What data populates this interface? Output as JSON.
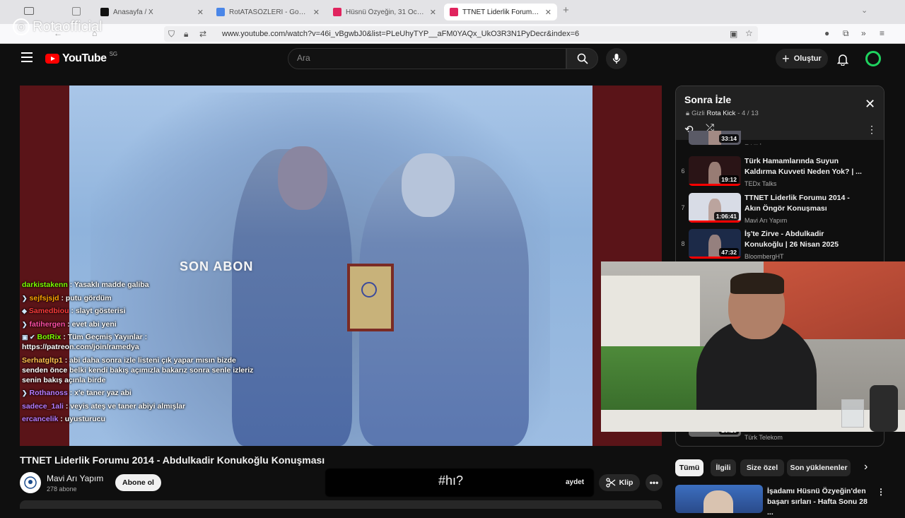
{
  "watermark": "Rotaofficial",
  "tabs": [
    {
      "label": "Anasayfa / X",
      "color": "#111111",
      "active": false
    },
    {
      "label": "RotATASÖZLERİ - Google Dokü",
      "color": "#4a86e8",
      "active": false
    },
    {
      "label": "Hüsnü Özyeğin, 31 Ocak 2017 İ",
      "color": "#e0245e",
      "active": false
    },
    {
      "label": "TTNET Liderlik Forumu 2014 - A",
      "color": "#e0245e",
      "active": true
    }
  ],
  "url": "www.youtube.com/watch?v=46i_vBgwbJ0&list=PLeUhyTYP__aFM0YAQx_UkO3R3N1PyDecr&index=6",
  "header": {
    "logo_text": "YouTube",
    "region": "SG",
    "search_placeholder": "Ara",
    "create_label": "Oluştur"
  },
  "video": {
    "caption": "SON ABON",
    "title": "TTNET Liderlik Forumu 2014 - Abdulkadir Konukoğlu Konuşması",
    "channel": "Mavi Arı Yapım",
    "subscribers": "278 abone",
    "subscribe_label": "Abone ol",
    "overlay_text": "#hı?",
    "save_partial": "aydet",
    "clip_label": "Klip"
  },
  "chat": [
    {
      "user": "darkistakenn",
      "color": "#7CFC00",
      "message": ": Yasaklı madde galiba",
      "badge": ""
    },
    {
      "user": "sejfsjsjd",
      "color": "#FFA500",
      "message": ": putu gördüm",
      "badge": "❯"
    },
    {
      "user": "Samedbiou",
      "color": "#FF3B3B",
      "message": ": slayt gösterisi",
      "badge": "◆"
    },
    {
      "user": "fatihergen",
      "color": "#FF4FA3",
      "message": ": evet abi yeni",
      "badge": "❯"
    },
    {
      "user": "BotRix",
      "color": "#7CFC00",
      "message": ": Tüm Geçmiş Yayınlar : https://patreon.com/join/ramedya",
      "badge": "▣ ✔"
    },
    {
      "user": "Serhatgltp1",
      "color": "#FFC04D",
      "message": ": abi daha sonra izle listeni çık yapar mısın bizde senden önce belki kendi bakış açımızla bakarız sonra senle izleriz senin bakış açınla birde",
      "badge": ""
    },
    {
      "user": "Rothanoss",
      "color": "#B77CFF",
      "message": ": x'e taner yaz abi",
      "badge": "❯"
    },
    {
      "user": "sadece_1ali",
      "color": "#B77CFF",
      "message": ": veyis ateş ve taner abiyi almışlar",
      "badge": ""
    },
    {
      "user": "ercancelik",
      "color": "#B77CFF",
      "message": ": uyusturucu",
      "badge": ""
    }
  ],
  "playlist": {
    "title": "Sonra İzle",
    "privacy": "Gizli",
    "owner": "Rota Kick",
    "position": "- 4 / 13",
    "items": [
      {
        "index": "",
        "duration": "33:14",
        "title": "",
        "channel": "Etkili İnsan",
        "progress": 0.0,
        "thumb": "#5a5a66"
      },
      {
        "index": "6",
        "duration": "19:12",
        "title": "Türk Hamamlarında Suyun Kaldırma Kuvveti Neden Yok? | ...",
        "channel": "TEDx Talks",
        "progress": 1.0,
        "thumb": "#2a1416"
      },
      {
        "index": "7",
        "duration": "1:06:41",
        "title": "TTNET Liderlik Forumu 2014 - Akın Öngör Konuşması",
        "channel": "Mavi Arı Yapım",
        "progress": 1.0,
        "thumb": "#d8dce6"
      },
      {
        "index": "8",
        "duration": "47:32",
        "title": "İş'te Zirve - Abdulkadir Konukoğlu | 26 Nisan 2025",
        "channel": "BloombergHT",
        "progress": 1.0,
        "thumb": "#1c2a48"
      }
    ],
    "last_channel": "Türk Telekom",
    "last_duration": "26:25"
  },
  "chips": [
    "Tümü",
    "İlgili",
    "Size özel",
    "Son yüklenenler"
  ],
  "recommendation": {
    "title": "İşadamı Hüsnü Özyeğin'den başarı sırları - Hafta Sonu 28 ..."
  }
}
